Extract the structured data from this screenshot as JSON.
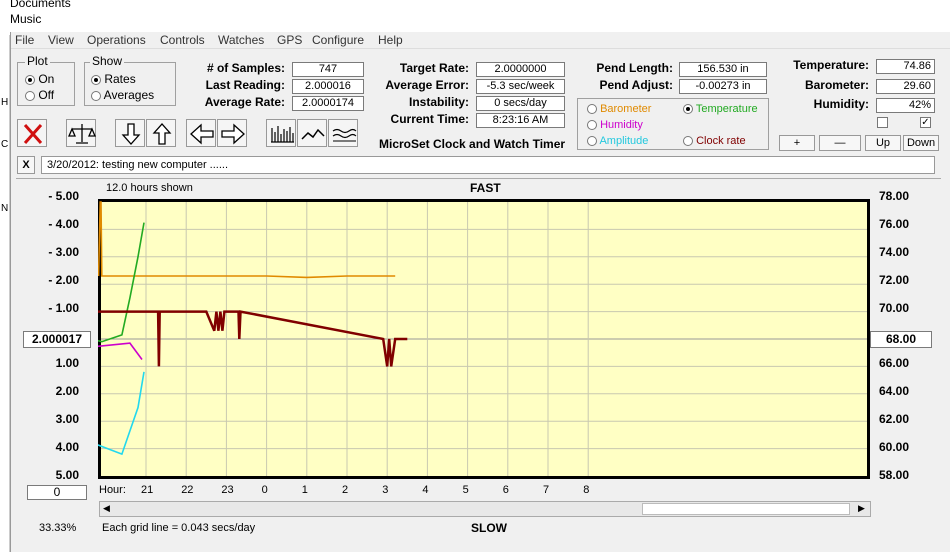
{
  "background": {
    "explorer_items": [
      "Documents",
      "Music"
    ],
    "sidebar_letters": [
      "H",
      "C",
      "N"
    ]
  },
  "menu": [
    "File",
    "View",
    "Operations",
    "Controls",
    "Watches",
    "GPS",
    "Configure",
    "Help"
  ],
  "plot_group": {
    "title": "Plot",
    "on": "On",
    "off": "Off",
    "selected": "On"
  },
  "show_group": {
    "title": "Show",
    "rates": "Rates",
    "averages": "Averages",
    "selected": "Rates"
  },
  "stats": {
    "samples_label": "# of Samples:",
    "samples": "747",
    "last_label": "Last Reading:",
    "last": "2.000016",
    "avg_label": "Average Rate:",
    "avg": "2.0000174",
    "target_label": "Target Rate:",
    "target": "2.0000000",
    "avgerr_label": "Average Error:",
    "avgerr": "-5.3 sec/week",
    "instab_label": "Instability:",
    "instab": "0 secs/day",
    "time_label": "Current Time:",
    "time": "8:23:16 AM",
    "app_title": "MicroSet Clock and Watch Timer",
    "pendlen_label": "Pend Length:",
    "pendlen": "156.530 in",
    "pendadj_label": "Pend Adjust:",
    "pendadj": "-0.00273 in",
    "temp_label": "Temperature:",
    "temp": "74.86",
    "baro_label": "Barometer:",
    "baro": "29.60",
    "hum_label": "Humidity:",
    "hum": "42%"
  },
  "sensor_radios": {
    "barometer": "Barometer",
    "temperature": "Temperature",
    "humidity": "Humidity",
    "amplitude": "Amplitude",
    "clock_rate": "Clock rate",
    "selected": "Temperature"
  },
  "scale_buttons": {
    "plus": "+",
    "minus": "—",
    "up": "Up",
    "down": "Down"
  },
  "notes": {
    "close": "X",
    "text": "3/20/2012: testing new computer ......"
  },
  "chart_header": {
    "hours_shown": "12.0 hours shown",
    "fast": "FAST",
    "slow": "SLOW"
  },
  "left_center_value": "2.000017",
  "right_center_value": "68.00",
  "left_bottom_value": "0",
  "hour_label": "Hour:",
  "footer": {
    "percent": "33.33%",
    "grid": "Each grid line = 0.043 secs/day"
  },
  "colors": {
    "orange": "#e08a00",
    "green": "#22aa22",
    "maroon": "#800000",
    "magenta": "#cc00cc",
    "cyan": "#22d8ee",
    "plot_bg": "#ffffc4"
  },
  "chart_data": {
    "type": "line",
    "title": "",
    "x_ticks": [
      "21",
      "22",
      "23",
      "0",
      "1",
      "2",
      "3",
      "4",
      "5",
      "6",
      "7",
      "8"
    ],
    "y_left_ticks": [
      "5.00",
      "4.00",
      "3.00",
      "2.00",
      "1.00",
      "1.00",
      "2.00",
      "3.00",
      "4.00",
      "5.00"
    ],
    "y_left_prefix": "-",
    "y_right_ticks": [
      "78.00",
      "76.00",
      "74.00",
      "72.00",
      "70.00",
      "66.00",
      "64.00",
      "62.00",
      "60.00",
      "58.00"
    ],
    "x_range": [
      19.8,
      28.0
    ],
    "x_dataspan": [
      19.8,
      27.2
    ],
    "y_range": [
      -5,
      5
    ],
    "series": [
      {
        "color": "#e08a00",
        "x": [
          19.82,
          19.86,
          19.88,
          19.9,
          20.5,
          22,
          23,
          24,
          25,
          26,
          27,
          27.2
        ],
        "values": [
          2.3,
          5.0,
          5.0,
          2.3,
          2.3,
          2.3,
          2.3,
          2.3,
          2.25,
          2.3,
          2.3,
          2.3
        ]
      },
      {
        "color": "#22aa22",
        "x": [
          19.8,
          20.0,
          20.5,
          21.0,
          21.6,
          22.0,
          23.0,
          24.0,
          25.0,
          26.0,
          27.0,
          28.0,
          28.8,
          29.3,
          29.8,
          30.0,
          30.2,
          30.35
        ],
        "values": [
          68.9,
          70.3,
          73.0,
          73.7,
          73.7,
          74.3,
          72.6,
          71.5,
          70.4,
          69.8,
          69.1,
          68.6,
          68.2,
          67.8,
          68.3,
          71.0,
          74.0,
          76.5
        ],
        "axis": "right",
        "x_map": "linear",
        "note": ""
      },
      {
        "color": "#800000",
        "x": [
          19.8,
          21.3,
          21.32,
          21.34,
          21.36,
          22.5,
          22.7,
          22.75,
          22.8,
          22.85,
          22.9,
          22.95,
          23.3,
          23.32,
          23.35,
          26.9,
          27.0,
          27.05,
          27.1,
          27.2,
          27.5
        ],
        "values": [
          1.0,
          1.0,
          -1.0,
          1.0,
          1.0,
          1.0,
          0.3,
          1.0,
          0.3,
          1.0,
          0.3,
          1.0,
          1.0,
          0.0,
          1.0,
          0.0,
          -1.0,
          0.0,
          -1.0,
          0.0,
          0.0
        ]
      },
      {
        "color": "#cc00cc",
        "x": [
          19.8,
          20.6,
          21.5,
          23.0,
          25.0,
          27.0,
          29.0,
          30.0,
          30.3
        ],
        "values": [
          67.4,
          66.4,
          66.6,
          66.7,
          67.1,
          67.3,
          67.4,
          67.7,
          66.5
        ],
        "axis": "right"
      },
      {
        "color": "#22d8ee",
        "x": [
          19.8,
          20.5,
          21.0,
          22.0,
          23.0,
          24.0,
          25.0,
          26.0,
          27.0,
          28.0,
          29.0,
          29.8,
          30.2,
          30.35
        ],
        "values": [
          67.0,
          67.6,
          66.7,
          66.0,
          64.8,
          64.0,
          62.8,
          61.8,
          61.7,
          61.0,
          60.5,
          59.6,
          63.0,
          65.6
        ],
        "axis": "right"
      }
    ]
  }
}
